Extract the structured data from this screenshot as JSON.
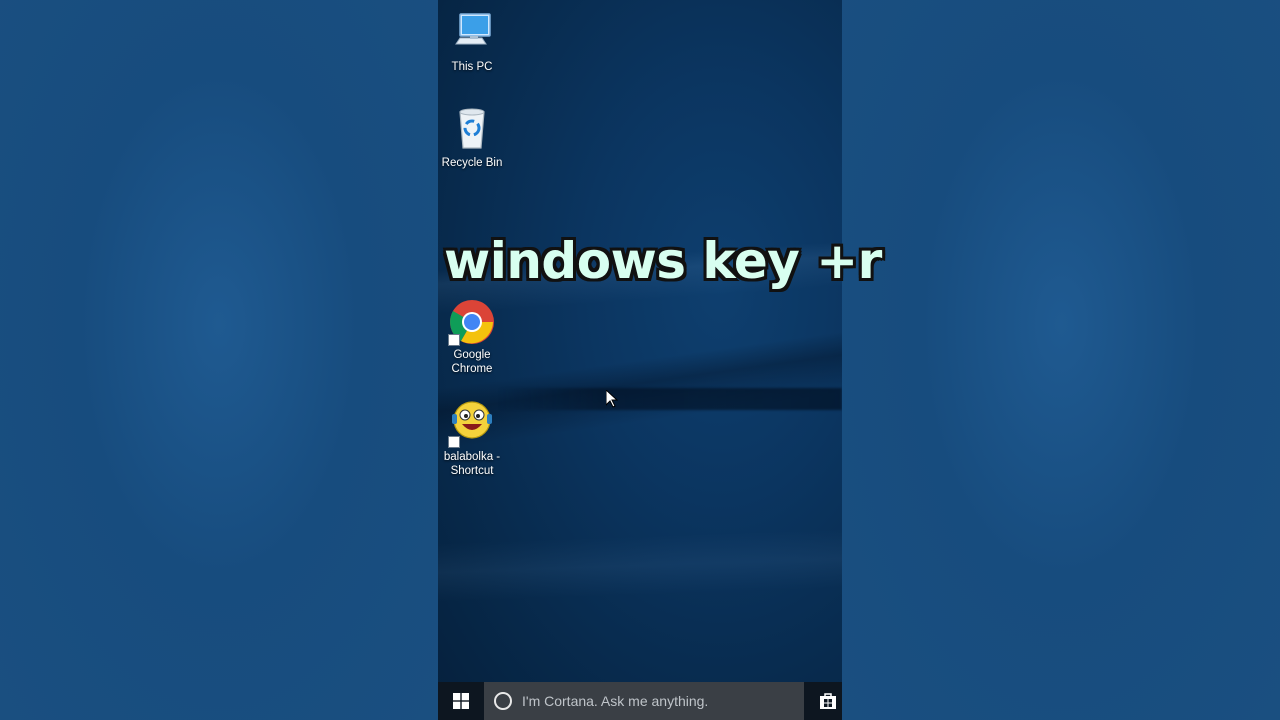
{
  "desktop": {
    "icons": [
      {
        "label": "This PC",
        "icon": "this-pc-icon"
      },
      {
        "label": "Recycle Bin",
        "icon": "recycle-bin-icon"
      },
      {
        "label": "Google Chrome",
        "icon": "chrome-icon"
      },
      {
        "label": "balabolka - Shortcut",
        "icon": "balabolka-icon"
      }
    ]
  },
  "overlay": {
    "caption": "windows key +r"
  },
  "taskbar": {
    "start_icon": "windows-logo-icon",
    "search": {
      "placeholder": "I'm Cortana. Ask me anything.",
      "icon": "cortana-circle-icon"
    },
    "store_icon": "store-icon"
  },
  "colors": {
    "caption_fill": "#d8fff0",
    "caption_outline": "#111111",
    "taskbar_bg": "#0d1620",
    "searchbox_bg": "#3a3f45"
  }
}
